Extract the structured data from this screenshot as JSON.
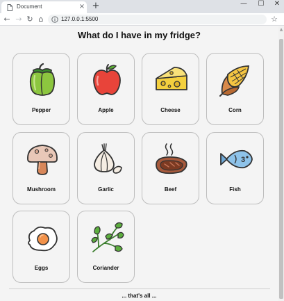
{
  "browser": {
    "tab_title": "Document",
    "tab_close": "×",
    "new_tab": "+",
    "url": "127.0.0.1:5500",
    "window_controls": {
      "minimize": "—",
      "maximize": "☐",
      "close": "✕"
    },
    "nav": {
      "back": "←",
      "forward": "→",
      "reload": "↻",
      "home": "⌂",
      "bookmark": "☆"
    }
  },
  "page": {
    "title": "What do I have in my fridge?",
    "footer": "... that's all ..."
  },
  "items": [
    {
      "label": "Pepper",
      "icon": "bell-pepper-icon"
    },
    {
      "label": "Apple",
      "icon": "apple-icon"
    },
    {
      "label": "Cheese",
      "icon": "cheese-icon"
    },
    {
      "label": "Corn",
      "icon": "corn-icon"
    },
    {
      "label": "Mushroom",
      "icon": "mushroom-icon"
    },
    {
      "label": "Garlic",
      "icon": "garlic-icon"
    },
    {
      "label": "Beef",
      "icon": "steak-icon"
    },
    {
      "label": "Fish",
      "icon": "fish-icon"
    },
    {
      "label": "Eggs",
      "icon": "fried-egg-icon"
    },
    {
      "label": "Coriander",
      "icon": "coriander-icon"
    }
  ]
}
